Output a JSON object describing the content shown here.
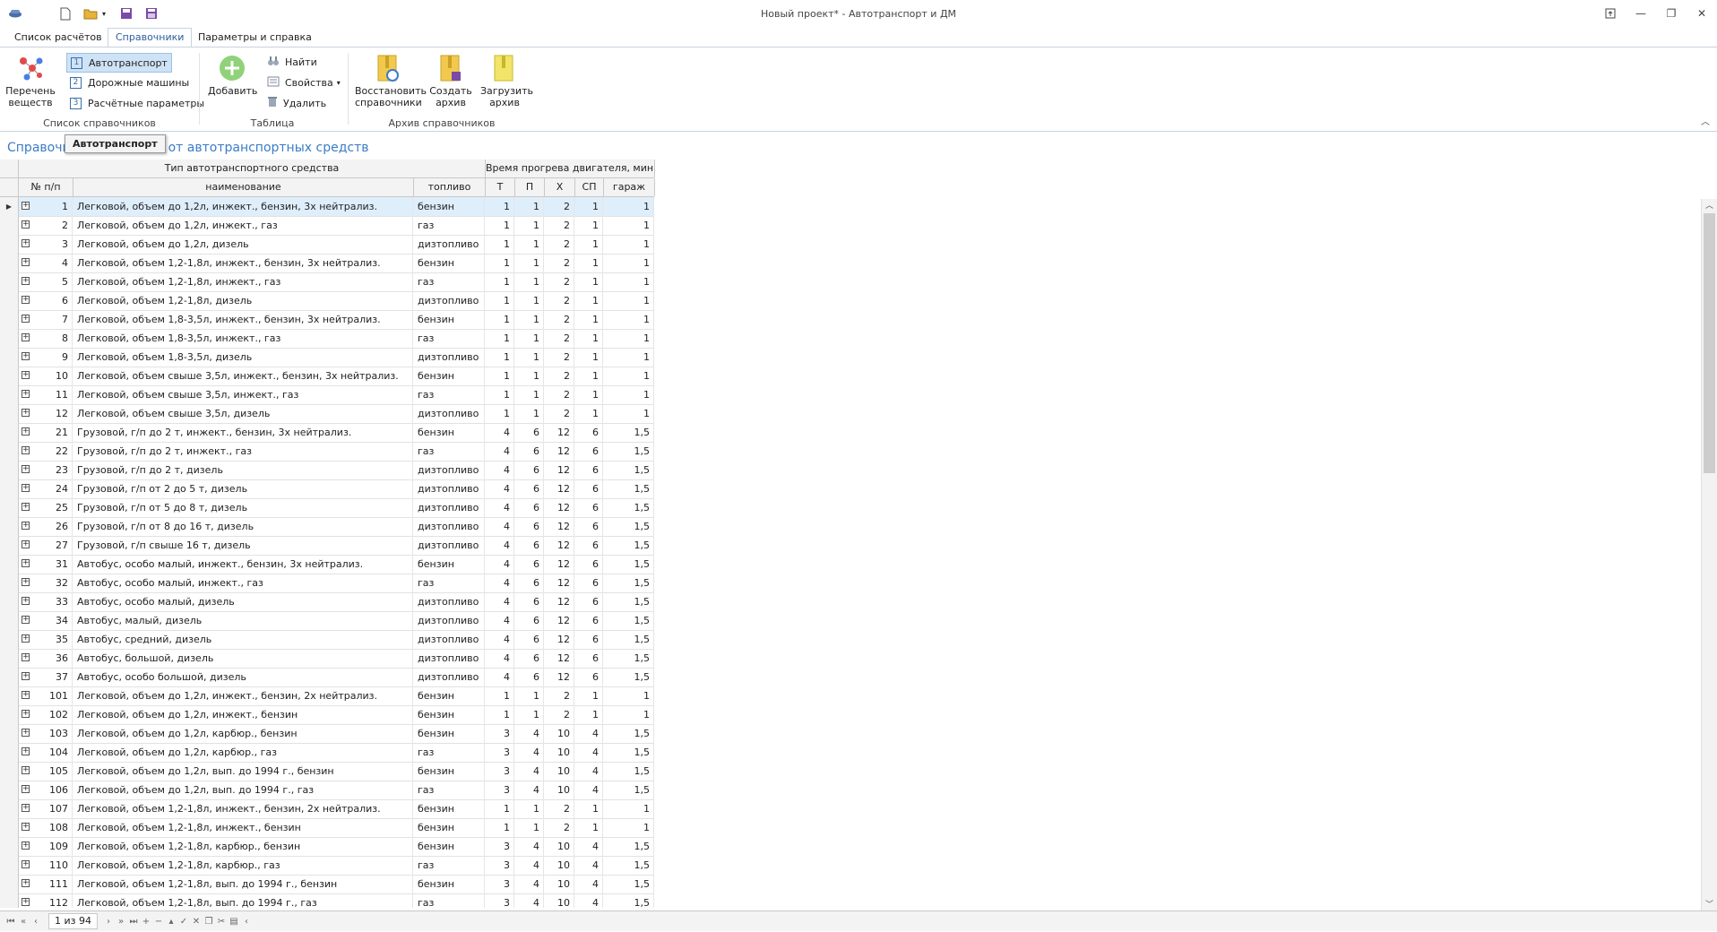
{
  "window": {
    "title": "Новый проект* - Автотранспорт и ДМ"
  },
  "ribbon": {
    "tabs": [
      "Список расчётов",
      "Справочники",
      "Параметры и справка"
    ],
    "active_tab": 1,
    "groups": {
      "list": {
        "label": "Список справочников",
        "substances_btn": "Перечень\nвеществ",
        "items": [
          "Автотранспорт",
          "Дорожные машины",
          "Расчётные параметры"
        ]
      },
      "table": {
        "label": "Таблица",
        "add_btn": "Добавить",
        "find_btn": "Найти",
        "props_btn": "Свойства",
        "delete_btn": "Удалить"
      },
      "archive": {
        "label": "Архив справочников",
        "restore_btn": "Восстановить\nсправочники",
        "create_btn": "Создать\nархив",
        "load_btn": "Загрузить\nархив"
      }
    }
  },
  "doc": {
    "title": "Справочник выделений от автотранспортных средств",
    "tooltip": "Автотранспорт"
  },
  "grid": {
    "band_vehicle": "Тип автотранспортного средства",
    "band_warmup": "Время прогрева двигателя, мин.",
    "columns": [
      "№ п/п",
      "наименование",
      "топливо",
      "Т",
      "П",
      "Х",
      "СП",
      "гараж"
    ],
    "rows": [
      [
        "1",
        "Легковой, объем до 1,2л, инжект., бензин, 3х нейтрализ.",
        "бензин",
        "1",
        "1",
        "2",
        "1",
        "1"
      ],
      [
        "2",
        "Легковой, объем до 1,2л, инжект., газ",
        "газ",
        "1",
        "1",
        "2",
        "1",
        "1"
      ],
      [
        "3",
        "Легковой, объем до 1,2л, дизель",
        "дизтопливо",
        "1",
        "1",
        "2",
        "1",
        "1"
      ],
      [
        "4",
        "Легковой, объем 1,2-1,8л, инжект., бензин, 3х нейтрализ.",
        "бензин",
        "1",
        "1",
        "2",
        "1",
        "1"
      ],
      [
        "5",
        "Легковой, объем 1,2-1,8л, инжект., газ",
        "газ",
        "1",
        "1",
        "2",
        "1",
        "1"
      ],
      [
        "6",
        "Легковой, объем 1,2-1,8л, дизель",
        "дизтопливо",
        "1",
        "1",
        "2",
        "1",
        "1"
      ],
      [
        "7",
        "Легковой, объем 1,8-3,5л, инжект., бензин, 3х нейтрализ.",
        "бензин",
        "1",
        "1",
        "2",
        "1",
        "1"
      ],
      [
        "8",
        "Легковой, объем 1,8-3,5л, инжект., газ",
        "газ",
        "1",
        "1",
        "2",
        "1",
        "1"
      ],
      [
        "9",
        "Легковой, объем 1,8-3,5л, дизель",
        "дизтопливо",
        "1",
        "1",
        "2",
        "1",
        "1"
      ],
      [
        "10",
        "Легковой, объем свыше 3,5л, инжект., бензин, 3х нейтрализ.",
        "бензин",
        "1",
        "1",
        "2",
        "1",
        "1"
      ],
      [
        "11",
        "Легковой, объем свыше 3,5л, инжект., газ",
        "газ",
        "1",
        "1",
        "2",
        "1",
        "1"
      ],
      [
        "12",
        "Легковой, объем свыше 3,5л, дизель",
        "дизтопливо",
        "1",
        "1",
        "2",
        "1",
        "1"
      ],
      [
        "21",
        "Грузовой, г/п до 2 т, инжект., бензин, 3х нейтрализ.",
        "бензин",
        "4",
        "6",
        "12",
        "6",
        "1,5"
      ],
      [
        "22",
        "Грузовой, г/п до 2 т, инжект., газ",
        "газ",
        "4",
        "6",
        "12",
        "6",
        "1,5"
      ],
      [
        "23",
        "Грузовой, г/п до 2 т, дизель",
        "дизтопливо",
        "4",
        "6",
        "12",
        "6",
        "1,5"
      ],
      [
        "24",
        "Грузовой, г/п от 2 до 5 т, дизель",
        "дизтопливо",
        "4",
        "6",
        "12",
        "6",
        "1,5"
      ],
      [
        "25",
        "Грузовой, г/п от 5 до 8 т, дизель",
        "дизтопливо",
        "4",
        "6",
        "12",
        "6",
        "1,5"
      ],
      [
        "26",
        "Грузовой, г/п от 8 до 16 т, дизель",
        "дизтопливо",
        "4",
        "6",
        "12",
        "6",
        "1,5"
      ],
      [
        "27",
        "Грузовой, г/п свыше 16 т, дизель",
        "дизтопливо",
        "4",
        "6",
        "12",
        "6",
        "1,5"
      ],
      [
        "31",
        "Автобус, особо малый, инжект., бензин, 3х нейтрализ.",
        "бензин",
        "4",
        "6",
        "12",
        "6",
        "1,5"
      ],
      [
        "32",
        "Автобус, особо малый, инжект., газ",
        "газ",
        "4",
        "6",
        "12",
        "6",
        "1,5"
      ],
      [
        "33",
        "Автобус, особо малый, дизель",
        "дизтопливо",
        "4",
        "6",
        "12",
        "6",
        "1,5"
      ],
      [
        "34",
        "Автобус, малый, дизель",
        "дизтопливо",
        "4",
        "6",
        "12",
        "6",
        "1,5"
      ],
      [
        "35",
        "Автобус, средний, дизель",
        "дизтопливо",
        "4",
        "6",
        "12",
        "6",
        "1,5"
      ],
      [
        "36",
        "Автобус, большой, дизель",
        "дизтопливо",
        "4",
        "6",
        "12",
        "6",
        "1,5"
      ],
      [
        "37",
        "Автобус, особо большой, дизель",
        "дизтопливо",
        "4",
        "6",
        "12",
        "6",
        "1,5"
      ],
      [
        "101",
        "Легковой, объем до 1,2л, инжект., бензин, 2х нейтрализ.",
        "бензин",
        "1",
        "1",
        "2",
        "1",
        "1"
      ],
      [
        "102",
        "Легковой, объем до 1,2л, инжект., бензин",
        "бензин",
        "1",
        "1",
        "2",
        "1",
        "1"
      ],
      [
        "103",
        "Легковой, объем до 1,2л, карбюр., бензин",
        "бензин",
        "3",
        "4",
        "10",
        "4",
        "1,5"
      ],
      [
        "104",
        "Легковой, объем до 1,2л, карбюр., газ",
        "газ",
        "3",
        "4",
        "10",
        "4",
        "1,5"
      ],
      [
        "105",
        "Легковой, объем до 1,2л, вып. до 1994 г., бензин",
        "бензин",
        "3",
        "4",
        "10",
        "4",
        "1,5"
      ],
      [
        "106",
        "Легковой, объем до 1,2л, вып. до 1994 г., газ",
        "газ",
        "3",
        "4",
        "10",
        "4",
        "1,5"
      ],
      [
        "107",
        "Легковой, объем 1,2-1,8л, инжект., бензин, 2х нейтрализ.",
        "бензин",
        "1",
        "1",
        "2",
        "1",
        "1"
      ],
      [
        "108",
        "Легковой, объем 1,2-1,8л, инжект., бензин",
        "бензин",
        "1",
        "1",
        "2",
        "1",
        "1"
      ],
      [
        "109",
        "Легковой, объем 1,2-1,8л, карбюр., бензин",
        "бензин",
        "3",
        "4",
        "10",
        "4",
        "1,5"
      ],
      [
        "110",
        "Легковой, объем 1,2-1,8л, карбюр., газ",
        "газ",
        "3",
        "4",
        "10",
        "4",
        "1,5"
      ],
      [
        "111",
        "Легковой, объем 1,2-1,8л, вып. до 1994 г., бензин",
        "бензин",
        "3",
        "4",
        "10",
        "4",
        "1,5"
      ],
      [
        "112",
        "Легковой, объем 1,2-1,8л, вып. до 1994 г., газ",
        "газ",
        "3",
        "4",
        "10",
        "4",
        "1,5"
      ]
    ]
  },
  "navigator": {
    "page_text": "1 из 94"
  },
  "colors": {
    "accent": "#3a7cc7",
    "selected_row": "#dfeefb",
    "ribbon_selected": "#cfe3f6"
  }
}
